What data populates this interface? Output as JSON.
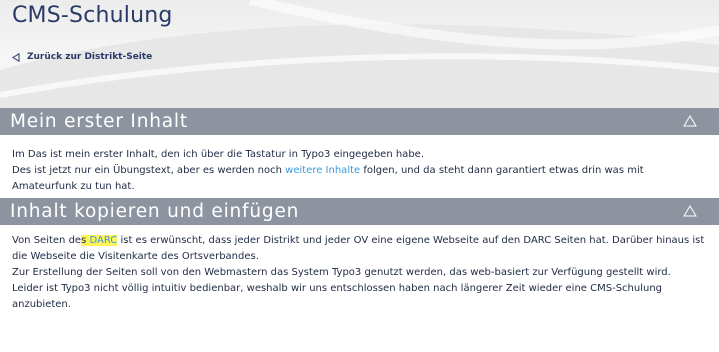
{
  "header": {
    "title": "CMS-Schulung",
    "back_link": "Zurück zur Distrikt-Seite"
  },
  "sections": [
    {
      "title": "Mein erster Inhalt",
      "paragraphs": [
        {
          "before": "Im Das ist mein erster Inhalt, den ich über die Tastatur in Typo3 eingegeben habe.",
          "line2_before": "Des ist jetzt nur ein Übungstext, aber es werden noch ",
          "link": "weitere Inhalte",
          "line2_after": " folgen, und da steht dann garantiert etwas drin was mit Amateurfunk zu tun hat."
        }
      ]
    },
    {
      "title": "Inhalt kopieren und einfügen",
      "paragraphs": [
        {
          "before": "Von Seiten de",
          "highlight_plain": "s ",
          "highlight_link": "DARC",
          "after": " ist es erwünscht, dass jeder Distrikt und jeder OV eine eigene Webseite auf den DARC Seiten hat. Darüber hinaus ist die Webseite die Visitenkarte des Ortsverbandes.",
          "line3": "Zur Erstellung der Seiten soll von den Webmastern das System Typo3 genutzt werden, das web-basiert zur Verfügung gestellt wird.",
          "line4": "Leider ist Typo3 nicht völlig intuitiv bedienbar, weshalb wir uns entschlossen haben nach längerer Zeit wieder eine CMS-Schulung anzubieten."
        }
      ]
    }
  ],
  "colors": {
    "accent": "#2a3a66",
    "section_bar": "#8d949f",
    "link": "#3a9ad9",
    "highlight": "#fff35c"
  },
  "icons": {
    "back": "triangle-left-icon",
    "collapse": "triangle-up-icon"
  }
}
